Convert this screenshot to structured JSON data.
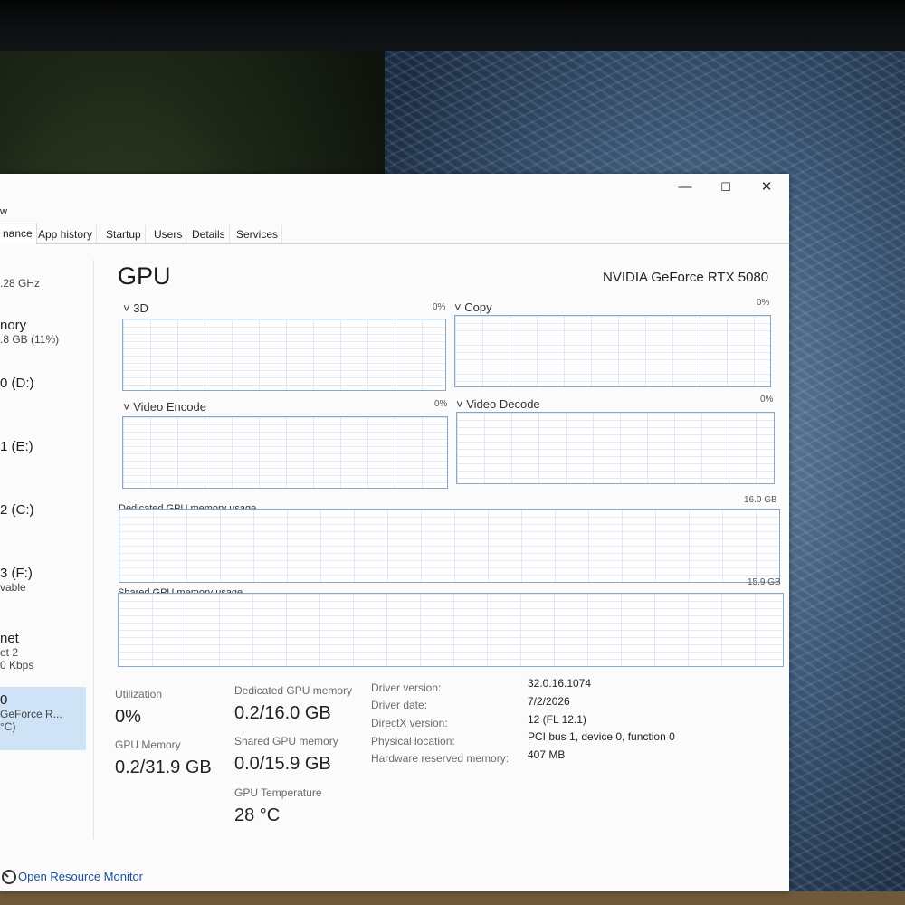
{
  "window": {
    "menu_fragment": "w",
    "minimize_glyph": "—",
    "maximize_glyph": "☐",
    "close_glyph": "✕"
  },
  "tabs": [
    {
      "label": "nance",
      "active": true
    },
    {
      "label": "App history"
    },
    {
      "label": "Startup"
    },
    {
      "label": "Users"
    },
    {
      "label": "Details"
    },
    {
      "label": "Services"
    }
  ],
  "sidebar": [
    {
      "line1": "",
      "line2": ".28 GHz"
    },
    {
      "line1": "nory",
      "line2": ".8 GB (11%)"
    },
    {
      "line1": "0 (D:)",
      "line2": ""
    },
    {
      "line1": "1 (E:)",
      "line2": ""
    },
    {
      "line1": "2 (C:)",
      "line2": ""
    },
    {
      "line1": "3 (F:)",
      "line2": "vable"
    },
    {
      "line1": "net",
      "line2": "et 2",
      "line3": "0 Kbps"
    },
    {
      "line1": "0",
      "line2": "GeForce R...",
      "line3": "°C)",
      "selected": true
    }
  ],
  "main": {
    "title": "GPU",
    "model": "NVIDIA GeForce RTX 5080",
    "graphs": [
      {
        "label": "3D",
        "percent": "0%"
      },
      {
        "label": "Copy",
        "percent": "0%"
      },
      {
        "label": "Video Encode",
        "percent": "0%"
      },
      {
        "label": "Video Decode",
        "percent": "0%"
      }
    ],
    "dedicated_graph": {
      "label": "Dedicated GPU memory usage",
      "max": "16.0 GB"
    },
    "shared_graph": {
      "label": "Shared GPU memory usage",
      "max": "15.9 GB"
    }
  },
  "stats": {
    "utilization_label": "Utilization",
    "utilization_value": "0%",
    "dedicated_label": "Dedicated GPU memory",
    "dedicated_value": "0.2/16.0 GB",
    "gpu_memory_label": "GPU Memory",
    "gpu_memory_value": "0.2/31.9 GB",
    "shared_label": "Shared GPU memory",
    "shared_value": "0.0/15.9 GB",
    "temp_label": "GPU Temperature",
    "temp_value": "28 °C"
  },
  "info": [
    {
      "label": "Driver version:",
      "value": "32.0.16.1074"
    },
    {
      "label": "Driver date:",
      "value": "7/2/2026"
    },
    {
      "label": "DirectX version:",
      "value": "12 (FL 12.1)"
    },
    {
      "label": "Physical location:",
      "value": "PCI bus 1, device 0, function 0"
    },
    {
      "label": "Hardware reserved memory:",
      "value": "407 MB"
    }
  ],
  "footer": {
    "link": "Open Resource Monitor"
  }
}
